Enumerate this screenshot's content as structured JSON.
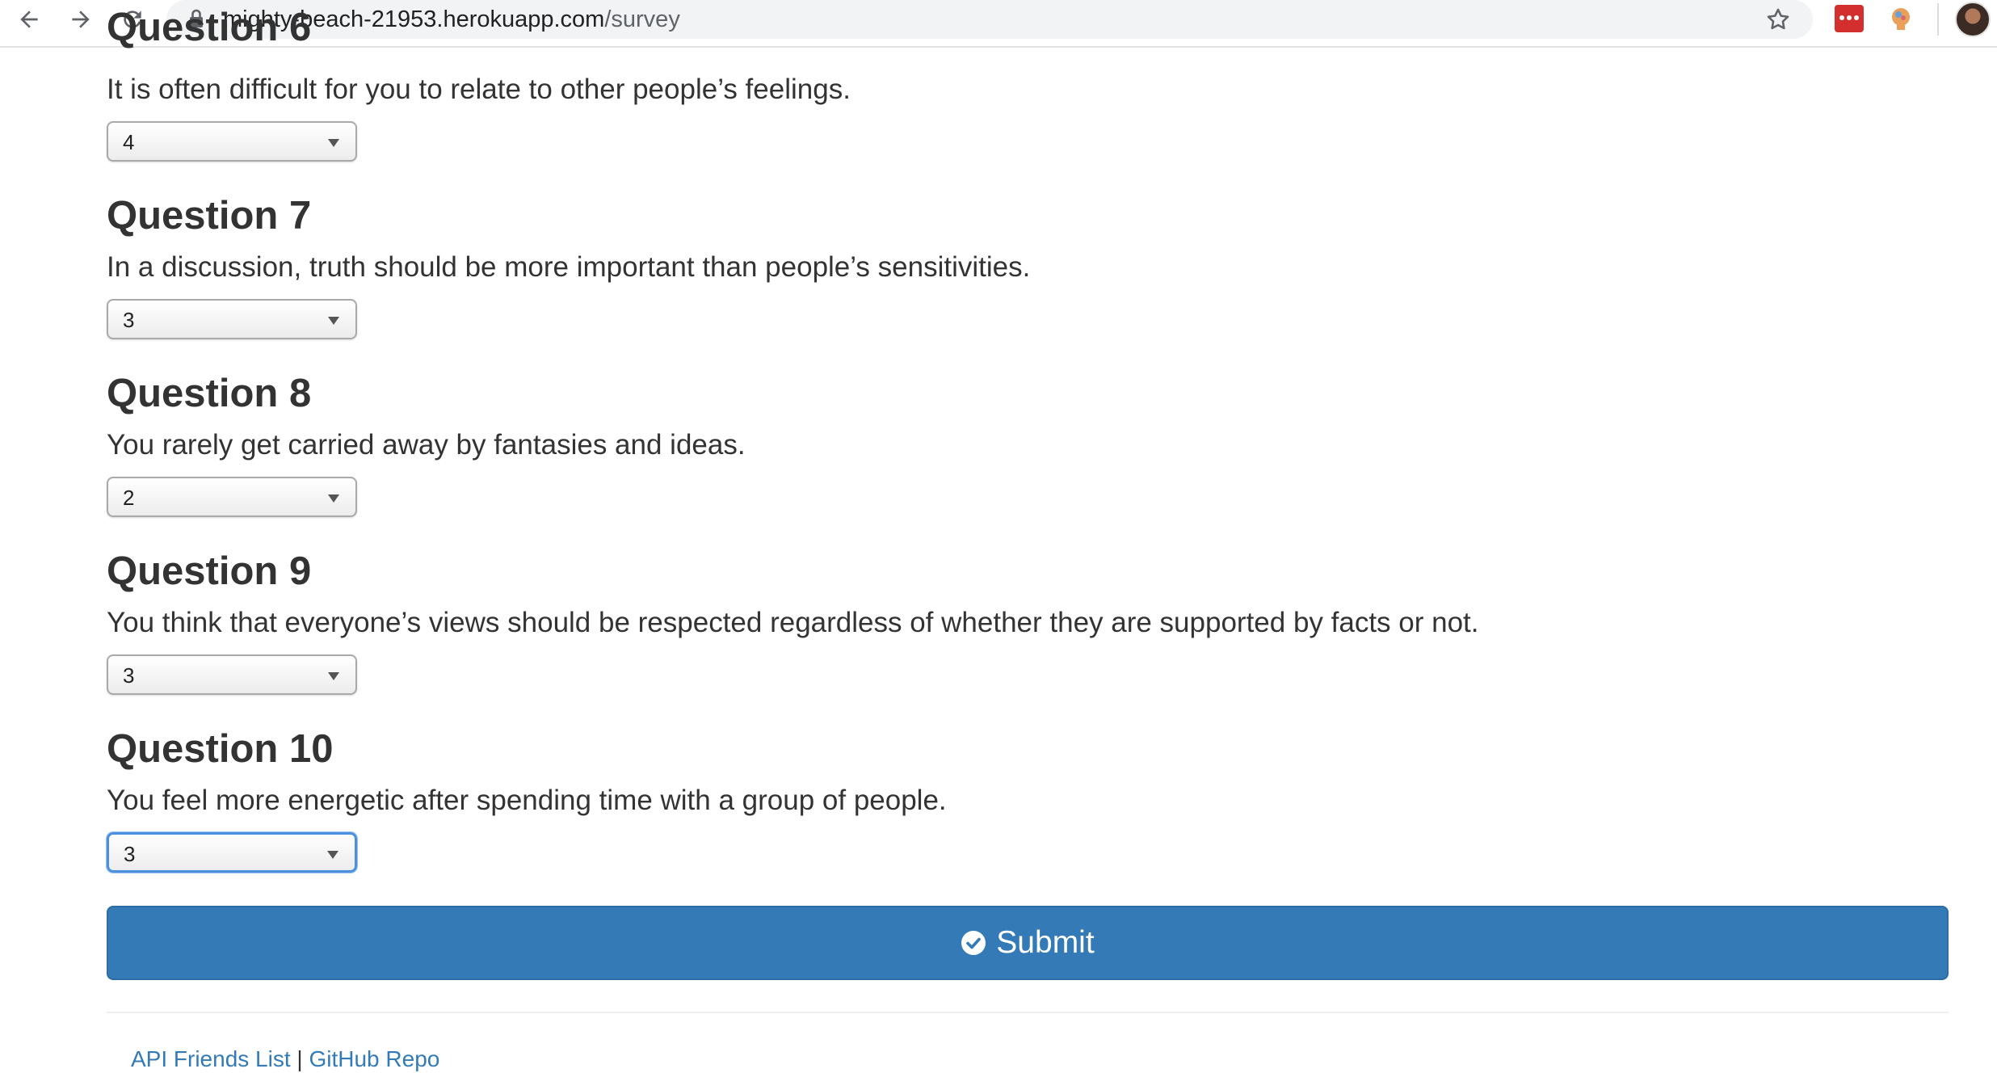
{
  "browser": {
    "url_host": "mighty-beach-21953.herokuapp.com",
    "url_path": "/survey"
  },
  "partial_heading": "Question 6",
  "questions": [
    {
      "text": "It is often difficult for you to relate to other people’s feelings.",
      "value": "4"
    },
    {
      "heading": "Question 7",
      "text": "In a discussion, truth should be more important than people’s sensitivities.",
      "value": "3"
    },
    {
      "heading": "Question 8",
      "text": "You rarely get carried away by fantasies and ideas.",
      "value": "2"
    },
    {
      "heading": "Question 9",
      "text": "You think that everyone’s views should be respected regardless of whether they are supported by facts or not.",
      "value": "3"
    },
    {
      "heading": "Question 10",
      "text": "You feel more energetic after spending time with a group of people.",
      "value": "3"
    }
  ],
  "submit": {
    "label": "Submit",
    "icon": "check-circle-icon"
  },
  "footer": {
    "link1": "API Friends List",
    "separator": "|",
    "link2": "GitHub Repo"
  },
  "colors": {
    "primary": "#337ab7",
    "text": "#333333",
    "focus": "#4a8fe0"
  }
}
